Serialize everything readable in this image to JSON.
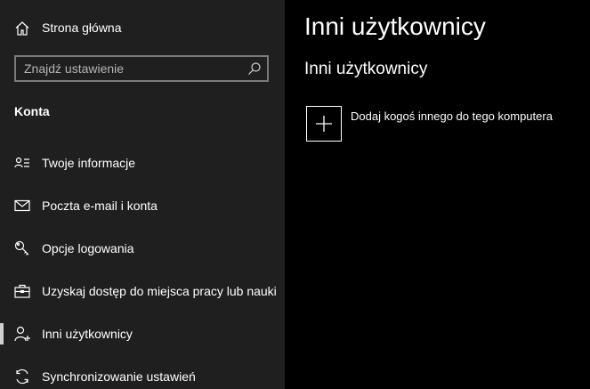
{
  "sidebar": {
    "home_label": "Strona główna",
    "search_placeholder": "Znajdź ustawienie",
    "section_title": "Konta",
    "items": [
      {
        "label": "Twoje informacje",
        "icon": "contact-card-icon"
      },
      {
        "label": "Poczta e-mail i konta",
        "icon": "mail-icon"
      },
      {
        "label": "Opcje logowania",
        "icon": "key-icon"
      },
      {
        "label": "Uzyskaj dostęp do miejsca pracy lub nauki",
        "icon": "briefcase-icon"
      },
      {
        "label": "Inni użytkownicy",
        "icon": "person-add-icon",
        "selected": true
      },
      {
        "label": "Synchronizowanie ustawień",
        "icon": "sync-icon"
      }
    ]
  },
  "main": {
    "page_title": "Inni użytkownicy",
    "section_title": "Inni użytkownicy",
    "add_user_label": "Dodaj kogoś innego do tego komputera"
  },
  "colors": {
    "sidebar_bg": "#1f1f1f",
    "main_bg": "#000000",
    "text": "#ffffff",
    "search_border": "#7a7a7a"
  }
}
